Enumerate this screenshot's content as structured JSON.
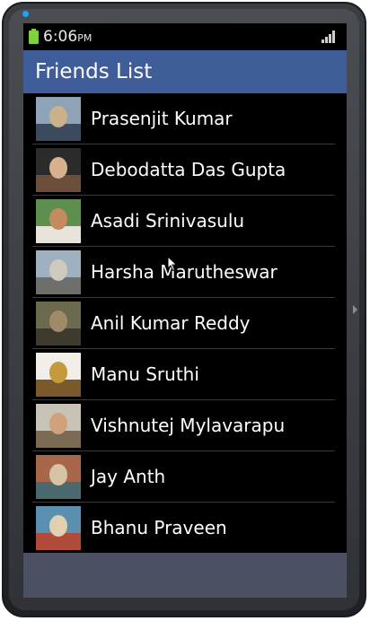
{
  "status_bar": {
    "time": "6:06",
    "ampm": "PM",
    "battery_icon": "battery-icon",
    "signal_icon": "signal-icon",
    "led_color": "#1aa3ff"
  },
  "app_bar": {
    "title": "Friends List",
    "color": "#3e5d99"
  },
  "friends": [
    {
      "name": "Prasenjit Kumar",
      "avatar": "avatar-photo"
    },
    {
      "name": "Debodatta Das Gupta",
      "avatar": "avatar-photo"
    },
    {
      "name": "Asadi Srinivasulu",
      "avatar": "avatar-photo"
    },
    {
      "name": "Harsha Marutheswar",
      "avatar": "avatar-photo"
    },
    {
      "name": "Anil Kumar Reddy",
      "avatar": "avatar-photo"
    },
    {
      "name": "Manu Sruthi",
      "avatar": "avatar-photo"
    },
    {
      "name": "Vishnutej Mylavarapu",
      "avatar": "avatar-photo"
    },
    {
      "name": "Jay Anth",
      "avatar": "avatar-photo"
    },
    {
      "name": "Bhanu Praveen",
      "avatar": "avatar-photo"
    }
  ]
}
